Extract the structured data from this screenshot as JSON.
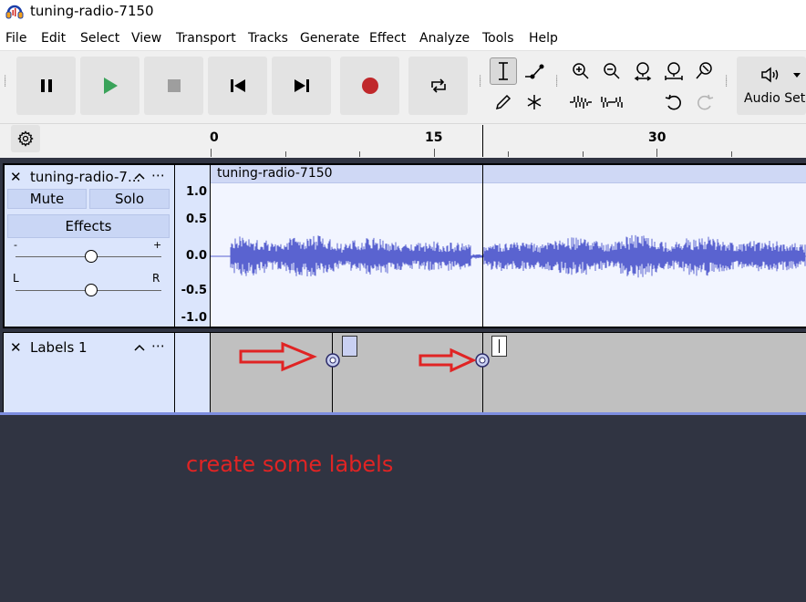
{
  "window": {
    "title": "tuning-radio-7150"
  },
  "menu": [
    "File",
    "Edit",
    "Select",
    "View",
    "Transport",
    "Tracks",
    "Generate",
    "Effect",
    "Analyze",
    "Tools",
    "Help"
  ],
  "toolbar": {
    "audio_setup_label": "Audio Setup",
    "icons": [
      "pause-icon",
      "play-icon",
      "stop-icon",
      "skip-start-icon",
      "skip-end-icon",
      "record-icon",
      "loop-icon",
      "selection-tool-icon",
      "envelope-tool-icon",
      "draw-tool-icon",
      "multi-tool-icon",
      "zoom-in-icon",
      "zoom-out-icon",
      "fit-selection-icon",
      "fit-project-icon",
      "zoom-toggle-icon",
      "trim-icon",
      "silence-icon",
      "undo-icon",
      "redo-icon",
      "speaker-icon"
    ]
  },
  "ruler": {
    "ticks": [
      "0",
      "15",
      "30"
    ]
  },
  "audio_track": {
    "name": "tuning-radio-7...",
    "clip_name": "tuning-radio-7150",
    "mute_label": "Mute",
    "solo_label": "Solo",
    "effects_label": "Effects",
    "gain_minus": "-",
    "gain_plus": "+",
    "pan_left": "L",
    "pan_right": "R",
    "gain_value": 0.5,
    "pan_value": 0.5,
    "vruler": [
      "1.0",
      "0.5",
      "0.0",
      "-0.5",
      "-1.0"
    ]
  },
  "label_track": {
    "name": "Labels 1"
  },
  "annotation": {
    "text": "create some labels",
    "color": "#e02424"
  },
  "colors": {
    "waveform": "#5a63d0",
    "track_bg": "#dbe5fc",
    "selected_border": "#7d8ee0",
    "background": "#303442"
  }
}
